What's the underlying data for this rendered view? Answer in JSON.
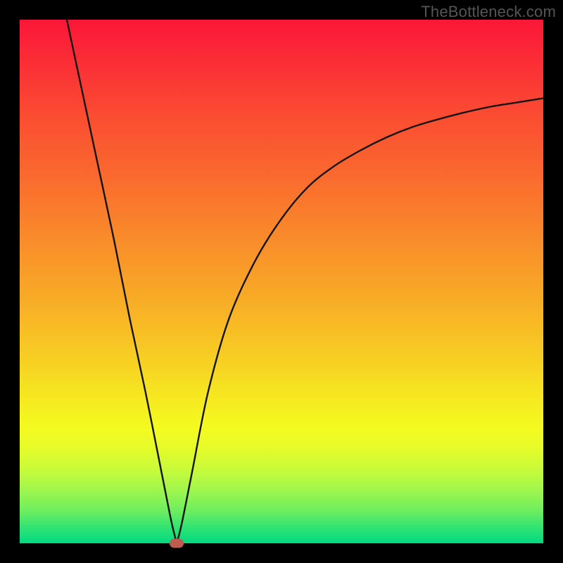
{
  "watermark": "TheBottleneck.com",
  "colors": {
    "frame": "#000000",
    "curve_stroke": "#141414",
    "marker_fill": "#c25b4f",
    "gradient_top": "#fb1638",
    "gradient_bottom": "#00da80"
  },
  "chart_data": {
    "type": "line",
    "title": "",
    "xlabel": "",
    "ylabel": "",
    "xlim": [
      0,
      100
    ],
    "ylim": [
      0,
      100
    ],
    "description": "V-shaped bottleneck curve over a red-to-green vertical gradient. Minimum (0) is at x≈30 (green = no bottleneck); value rises sharply toward 0 and toward 100 (red = bottlenecked).",
    "series": [
      {
        "name": "bottleneck-curve",
        "x": [
          9,
          12,
          15,
          18,
          21,
          24,
          27,
          29,
          30,
          31,
          33,
          36,
          40,
          45,
          50,
          55,
          60,
          65,
          70,
          75,
          80,
          85,
          90,
          95,
          100
        ],
        "values": [
          100,
          86,
          72,
          58,
          43,
          29,
          14,
          4,
          0,
          4,
          14,
          29,
          43,
          54,
          62,
          68,
          72,
          75,
          77.5,
          79.5,
          81,
          82.3,
          83.4,
          84.2,
          85
        ]
      }
    ],
    "marker": {
      "x": 30,
      "y": 0,
      "name": "optimal-point"
    }
  }
}
